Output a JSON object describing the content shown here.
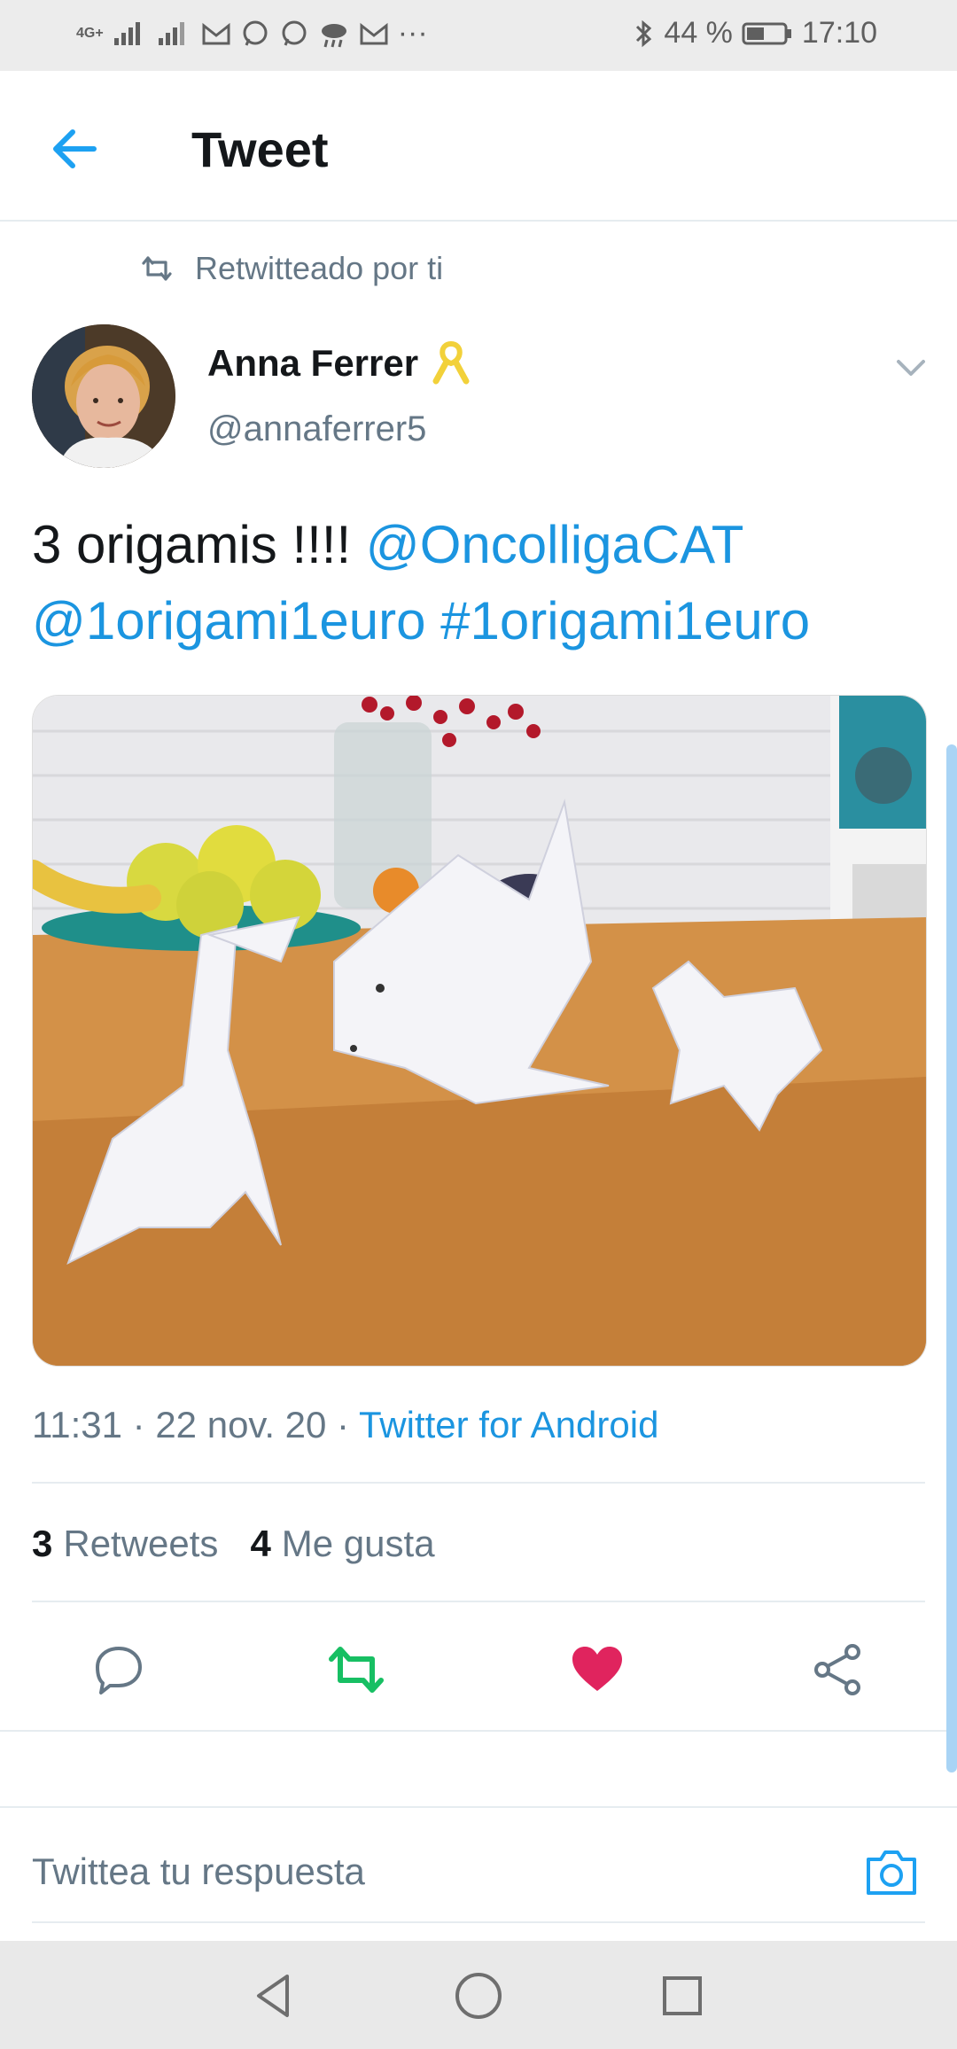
{
  "status_bar": {
    "network": "4G+",
    "battery": "44 %",
    "time": "17:10",
    "overflow": "···"
  },
  "header": {
    "title": "Tweet"
  },
  "retweet": {
    "label": "Retwitteado por ti"
  },
  "author": {
    "name": "Anna Ferrer",
    "handle": "@annaferrer5",
    "badge_icon": "yellow-ribbon-icon"
  },
  "tweet": {
    "text_plain": "3 origamis !!!! ",
    "mention1": "@OncolligaCAT",
    "mention2": "@1origami1euro",
    "hashtag": "#1origami1euro"
  },
  "meta": {
    "time": "11:31",
    "separator": " · ",
    "date": "22 nov. 20",
    "source": "Twitter for Android"
  },
  "stats": {
    "retweets_count": "3",
    "retweets_label": "Retweets",
    "likes_count": "4",
    "likes_label": "Me gusta"
  },
  "reply": {
    "placeholder": "Twittea tu respuesta"
  },
  "colors": {
    "accent": "#1da1f2",
    "link": "#1b95e0",
    "retweet_green": "#17bf63",
    "like_red": "#e0245e",
    "muted": "#657786"
  }
}
